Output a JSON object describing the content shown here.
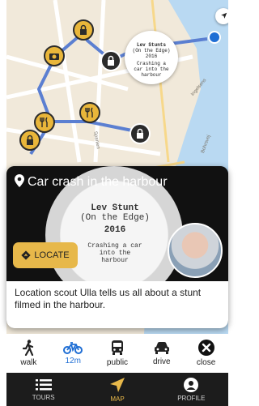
{
  "map": {
    "streets": [
      "Spanien",
      "Bohrsvej",
      "Ingelsens"
    ],
    "thumbnail": {
      "line1": "Lev Stunts",
      "line2": "(On the Edge)",
      "line3": "2016",
      "line4": "Crashing a car into the harbour"
    }
  },
  "card": {
    "title": "Car crash in the harbour",
    "poster": {
      "line1": "Lev Stunt",
      "line2": "(On the Edge)",
      "line3": "2016",
      "line4a": "Crashing a car",
      "line4b": "into the",
      "line4c": "harbour"
    },
    "locate_label": "LOCATE",
    "description": "Location scout Ulla tells us all about a stunt filmed in the harbour."
  },
  "modes": [
    {
      "label": "walk",
      "icon": "walk-icon"
    },
    {
      "label": "12m",
      "icon": "bike-icon",
      "active": true
    },
    {
      "label": "public",
      "icon": "bus-icon"
    },
    {
      "label": "drive",
      "icon": "car-icon"
    },
    {
      "label": "close",
      "icon": "close-icon"
    }
  ],
  "tabs": [
    {
      "label": "TOURS",
      "icon": "list-icon"
    },
    {
      "label": "MAP",
      "icon": "navigation-icon",
      "active": true
    },
    {
      "label": "PROFILE",
      "icon": "profile-icon"
    }
  ],
  "colors": {
    "accent": "#e7b84a",
    "route": "#5b7fd1",
    "water": "#b9d9f2",
    "active_mode": "#1f6ed4"
  }
}
